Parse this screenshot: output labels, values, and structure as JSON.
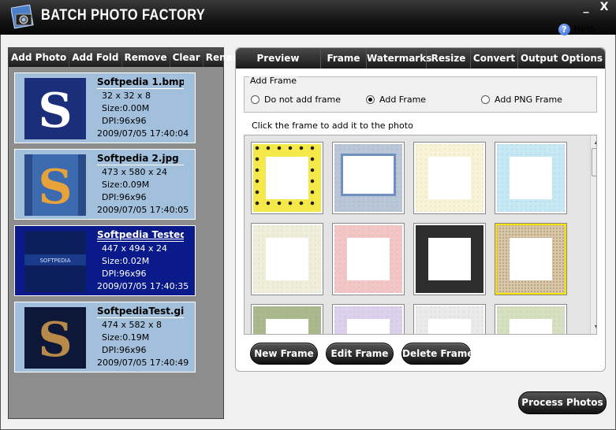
{
  "window": {
    "title": "BATCH PHOTO FACTORY",
    "minimize_glyph": "_",
    "close_glyph": "X",
    "help_label": "Help"
  },
  "left_toolbar": {
    "items": [
      "Add Photo",
      "Add Fold",
      "Remove",
      "Clear",
      "Rename"
    ]
  },
  "files": [
    {
      "name": "Softpedia 1.bmp",
      "dims": "32 x 32 x 8",
      "size": "Size:0.00M",
      "dpi": "DPI:96x96",
      "date": "2009/07/05 17:40:04",
      "selected": false
    },
    {
      "name": "Softpedia 2.jpg",
      "dims": "473 x 580 x 24",
      "size": "Size:0.09M",
      "dpi": "DPI:96x96",
      "date": "2009/07/05 17:40:05",
      "selected": false
    },
    {
      "name": "Softpedia Tested.jp",
      "dims": "447 x 494 x 24",
      "size": "Size:0.02M",
      "dpi": "DPI:96x96",
      "date": "2009/07/05 17:40:35",
      "selected": true
    },
    {
      "name": "SoftpediaTest.gif",
      "dims": "474 x 582 x 8",
      "size": "Size:0.19M",
      "dpi": "DPI:96x96",
      "date": "2009/07/05 17:40:49",
      "selected": false
    }
  ],
  "tabs": [
    "Preview",
    "Frame",
    "Watermarks",
    "Resize",
    "Convert",
    "Output Options"
  ],
  "add_frame": {
    "group_label": "Add Frame",
    "options": [
      {
        "label": "Do not add frame",
        "checked": false
      },
      {
        "label": "Add Frame",
        "checked": true
      },
      {
        "label": "Add PNG Frame",
        "checked": false
      }
    ],
    "hint": "Click the frame to add it to the photo"
  },
  "frames": [
    {
      "color": "#f4e84a",
      "kind": "dotted"
    },
    {
      "color": "#b9c6d8",
      "kind": "player"
    },
    {
      "color": "#f8f3d6",
      "kind": "plain"
    },
    {
      "color": "#c6e7f4",
      "kind": "plain"
    },
    {
      "color": "#eeeedb",
      "kind": "plain"
    },
    {
      "color": "#f3c6c6",
      "kind": "plain"
    },
    {
      "color": "#2e2e2e",
      "kind": "plain"
    },
    {
      "color": "#d8c6a8",
      "kind": "speckled"
    },
    {
      "color": "#a9b98c",
      "kind": "plain"
    },
    {
      "color": "#dcd0ec",
      "kind": "plain"
    },
    {
      "color": "#eaeaea",
      "kind": "plain"
    },
    {
      "color": "#d6dfbf",
      "kind": "plain"
    }
  ],
  "frame_buttons": {
    "new": "New Frame",
    "edit": "Edit Frame",
    "delete": "Delete Frame"
  },
  "process_button": "Process Photos",
  "icons": {
    "logo": "camera-logo-icon",
    "help": "help-icon",
    "scroll_up": "scroll-up-icon",
    "scroll_down": "scroll-down-icon"
  },
  "colors": {
    "titlebar": "#151515",
    "file_item_bg": "#a2bfdc",
    "file_item_selected_bg": "#0a1a8a",
    "left_panel_bg": "#8d8d8d"
  }
}
